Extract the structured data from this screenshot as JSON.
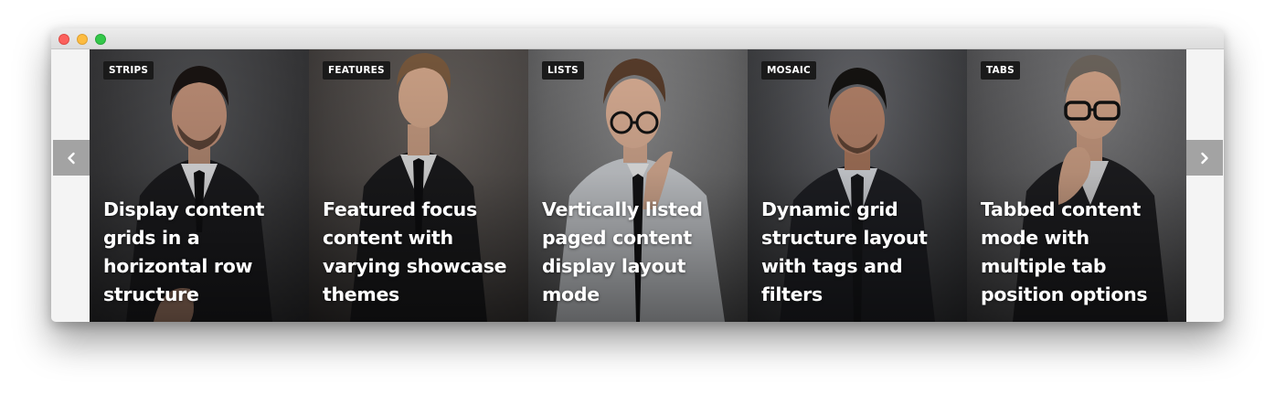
{
  "window": {
    "controls": [
      "close",
      "minimize",
      "maximize"
    ]
  },
  "slider": {
    "prev_icon": "chevron-left-icon",
    "next_icon": "chevron-right-icon",
    "cards": [
      {
        "tag": "STRIPS",
        "title": "Display content grids in a horizontal row structure",
        "bg_color": "#3b3b3d"
      },
      {
        "tag": "FEATURES",
        "title": "Featured focus content with varying showcase themes",
        "bg_color": "#4a4644"
      },
      {
        "tag": "LISTS",
        "title": "Vertically listed paged content display layout mode",
        "bg_color": "#6b6b6c"
      },
      {
        "tag": "MOSAIC",
        "title": "Dynamic grid structure layout with tags and filters",
        "bg_color": "#444548"
      },
      {
        "tag": "TABS",
        "title": "Tabbed content mode with multiple tab position options",
        "bg_color": "#5a5a5c"
      }
    ]
  }
}
